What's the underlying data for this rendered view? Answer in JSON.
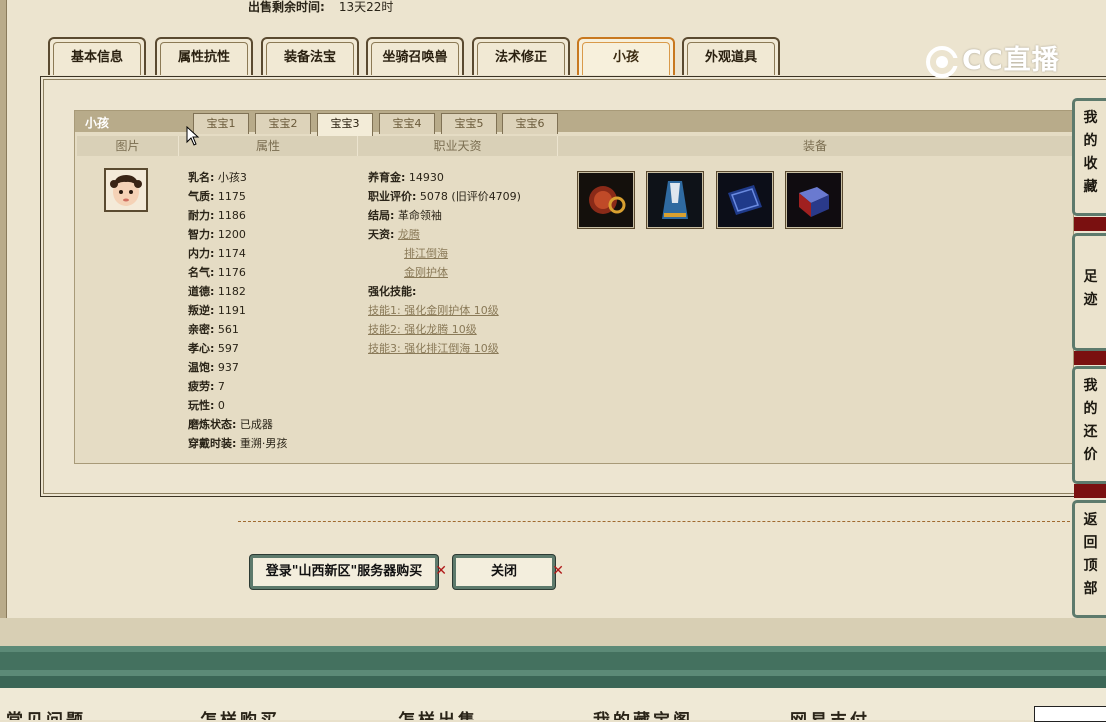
{
  "header": {
    "sale_label": "出售剩余时间:",
    "sale_value": "13天22时"
  },
  "main_tabs": [
    "基本信息",
    "属性抗性",
    "装备法宝",
    "坐骑召唤兽",
    "法术修正",
    "小孩",
    "外观道具"
  ],
  "active_main_tab": "小孩",
  "panel_title": "小孩",
  "sub_tabs": [
    "宝宝1",
    "宝宝2",
    "宝宝3",
    "宝宝4",
    "宝宝5",
    "宝宝6"
  ],
  "active_sub_tab": "宝宝3",
  "columns": {
    "image": "图片",
    "attrs": "属性",
    "prof": "职业天资",
    "equip": "装备"
  },
  "attributes": [
    {
      "k": "乳名:",
      "v": "小孩3"
    },
    {
      "k": "气质:",
      "v": "1175"
    },
    {
      "k": "耐力:",
      "v": "1186"
    },
    {
      "k": "智力:",
      "v": "1200"
    },
    {
      "k": "内力:",
      "v": "1174"
    },
    {
      "k": "名气:",
      "v": "1176"
    },
    {
      "k": "道德:",
      "v": "1182"
    },
    {
      "k": "叛逆:",
      "v": "1191"
    },
    {
      "k": "亲密:",
      "v": "561"
    },
    {
      "k": "孝心:",
      "v": "597"
    },
    {
      "k": "温饱:",
      "v": "937"
    },
    {
      "k": "疲劳:",
      "v": "7"
    },
    {
      "k": "玩性:",
      "v": "0"
    },
    {
      "k": "磨炼状态:",
      "v": "已成器"
    },
    {
      "k": "穿戴时装:",
      "v": "重溯·男孩"
    }
  ],
  "profession": {
    "fund_label": "养育金:",
    "fund_value": "14930",
    "eval_label": "职业评价:",
    "eval_value": "5078 (旧评价4709)",
    "ending_label": "结局:",
    "ending_value": "革命领袖",
    "talent_label": "天资:",
    "talents": [
      "龙腾",
      "排江倒海",
      "金刚护体"
    ],
    "skill_label": "强化技能:",
    "skills": [
      "技能1: 强化金刚护体 10级",
      "技能2: 强化龙腾 10级",
      "技能3: 强化排江倒海 10级"
    ]
  },
  "buttons": {
    "login_buy": "登录\"山西新区\"服务器购买",
    "close": "关闭"
  },
  "side_nav": {
    "favorites": [
      "我",
      "的",
      "收",
      "藏"
    ],
    "footprints": [
      "足",
      "迹"
    ],
    "my_offers": [
      "我",
      "的",
      "还",
      "价"
    ],
    "back_top": [
      "返",
      "回",
      "顶",
      "部"
    ]
  },
  "logo_text": "CC直播",
  "footer_links": [
    "常见问题",
    "怎样购买",
    "怎样出售",
    "我的藏宝阁",
    "网易支付"
  ]
}
